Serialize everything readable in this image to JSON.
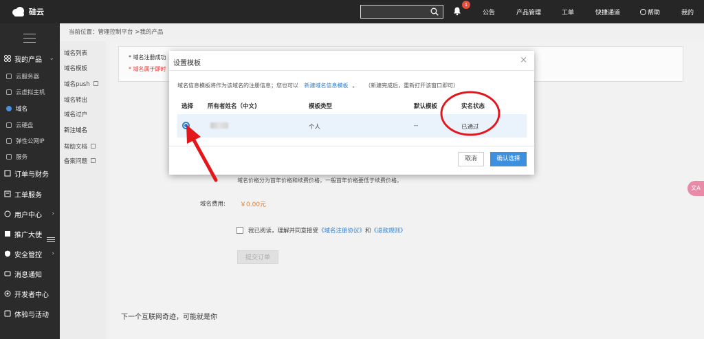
{
  "app": {
    "logo_text": "硅云"
  },
  "topbar": {
    "search_placeholder": "",
    "notification_count": "1",
    "nav": [
      "公告",
      "产品管理",
      "工单",
      "快捷通道",
      "帮助",
      "我的"
    ]
  },
  "sidebar": {
    "groups": [
      {
        "label": "我的产品",
        "expanded": true
      },
      {
        "label": "订单与财务"
      },
      {
        "label": "工单服务"
      },
      {
        "label": "用户中心"
      },
      {
        "label": "推广大使"
      },
      {
        "label": "安全管控"
      },
      {
        "label": "消息通知"
      },
      {
        "label": "开发者中心"
      },
      {
        "label": "体验与活动"
      }
    ],
    "product_items": [
      "云服务器",
      "云虚拟主机",
      "域名",
      "云硬盘",
      "弹性公网IP",
      "服务"
    ],
    "active_item": "域名"
  },
  "breadcrumb": "当前位置：管理控制平台 >我的产品",
  "submenu": {
    "items": [
      "域名列表",
      "域名模板",
      "域名push",
      "域名转出",
      "域名过户",
      "新注域名",
      "帮助文档",
      "备案问题"
    ],
    "active": "新注域名"
  },
  "main": {
    "notice_1": "域名注册成功",
    "notice_2": "域名属于即时",
    "price_note": "域名价格分为首年价格和续费价格，一般首年价格要低于续费价格。",
    "price_label": "域名费用:",
    "price_value": "￥0.00元",
    "agree_text_1": "我已阅读，理解并同意接受",
    "agree_link_1": "《域名注册协议》",
    "agree_and": "和",
    "agree_link_2": "《退款规则》",
    "submit_label": "提交订单",
    "footer_text": "下一个互联网奇迹，可能就是你",
    "translate_label": "文A"
  },
  "modal": {
    "title": "设置模板",
    "close": "×",
    "desc_1": "域名信息模板将作为该域名的注册信息；您也可以",
    "desc_link": "新建域名信息模板",
    "desc_dot": "。",
    "desc_2": "（新建完成后，重新打开该窗口即可）",
    "columns": [
      "选择",
      "所有者姓名（中文)",
      "模板类型",
      "默认模板",
      "实名状态"
    ],
    "rows": [
      {
        "owner": "",
        "type": "个人",
        "default": "--",
        "status": "已通过",
        "selected": true
      }
    ],
    "cancel_label": "取消",
    "confirm_label": "确认选择"
  },
  "annotation_colors": {
    "circle": "#e3161b",
    "arrow": "#e3161b"
  }
}
